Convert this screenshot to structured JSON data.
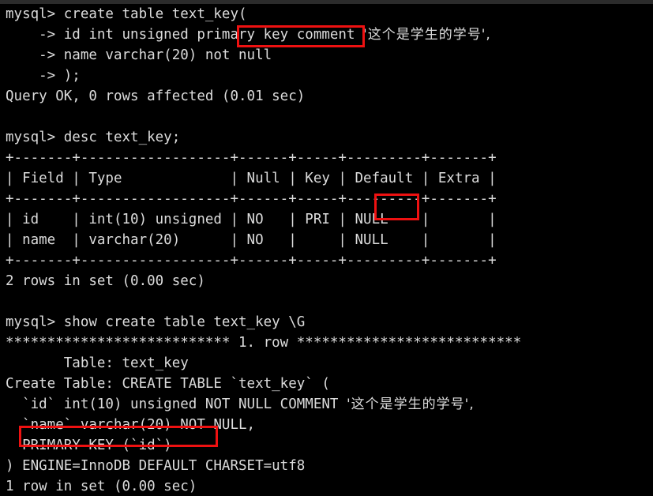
{
  "terminal": {
    "title": "mysql-client-terminal",
    "prompt": "mysql>",
    "background_color": "#000000",
    "text_color": "#dcdcdc",
    "highlight_color": "#ee1111",
    "lines": [
      {
        "id": "l01",
        "text": "mysql> create table text_key("
      },
      {
        "id": "l02",
        "text": "    -> id int unsigned primary key comment ",
        "cn": "'这个是学生的学号',"
      },
      {
        "id": "l03",
        "text": "    -> name varchar(20) not null"
      },
      {
        "id": "l04",
        "text": "    -> );"
      },
      {
        "id": "l05",
        "text": "Query OK, 0 rows affected (0.01 sec)"
      },
      {
        "id": "l06",
        "text": ""
      },
      {
        "id": "l07",
        "text": "mysql> desc text_key;"
      },
      {
        "id": "l08",
        "text": "+-------+------------------+------+-----+---------+-------+"
      },
      {
        "id": "l09",
        "text": "| Field | Type             | Null | Key | Default | Extra |"
      },
      {
        "id": "l10",
        "text": "+-------+------------------+------+-----+---------+-------+"
      },
      {
        "id": "l11",
        "text": "| id    | int(10) unsigned | NO   | PRI | NULL    |       |"
      },
      {
        "id": "l12",
        "text": "| name  | varchar(20)      | NO   |     | NULL    |       |"
      },
      {
        "id": "l13",
        "text": "+-------+------------------+------+-----+---------+-------+"
      },
      {
        "id": "l14",
        "text": "2 rows in set (0.00 sec)"
      },
      {
        "id": "l15",
        "text": ""
      },
      {
        "id": "l16",
        "text": "mysql> show create table text_key \\G"
      },
      {
        "id": "l17",
        "text": "*************************** 1. row ***************************"
      },
      {
        "id": "l18",
        "text": "       Table: text_key"
      },
      {
        "id": "l19",
        "text": "Create Table: CREATE TABLE `text_key` ("
      },
      {
        "id": "l20",
        "text": "  `id` int(10) unsigned NOT NULL COMMENT ",
        "cn": "'这个是学生的学号',"
      },
      {
        "id": "l21",
        "text": "  `name` varchar(20) NOT NULL,"
      },
      {
        "id": "l22",
        "text": "  PRIMARY KEY (`id`)"
      },
      {
        "id": "l23",
        "text": ") ENGINE=InnoDB DEFAULT CHARSET=utf8"
      },
      {
        "id": "l24",
        "text": "1 row in set (0.00 sec)"
      }
    ]
  },
  "annotations": {
    "box_primary_key": {
      "label": "primary key",
      "name": "highlight-primary-key-clause"
    },
    "box_pri": {
      "label": "PRI",
      "name": "highlight-pri-key-column-value"
    },
    "box_primary_key_def": {
      "label": "PRIMARY KEY (`id`)",
      "name": "highlight-primary-key-definition"
    }
  },
  "statements": {
    "create_table": "create table text_key( id int unsigned primary key comment '这个是学生的学号', name varchar(20) not null );",
    "desc": "desc text_key;",
    "show_create": "show create table text_key \\G"
  },
  "results": {
    "create_status": "Query OK, 0 rows affected (0.01 sec)",
    "desc_status": "2 rows in set (0.00 sec)",
    "show_create_status": "1 row in set (0.00 sec)"
  },
  "desc_table": {
    "columns": [
      "Field",
      "Type",
      "Null",
      "Key",
      "Default",
      "Extra"
    ],
    "rows": [
      [
        "id",
        "int(10) unsigned",
        "NO",
        "PRI",
        "NULL",
        ""
      ],
      [
        "name",
        "varchar(20)",
        "NO",
        "",
        "NULL",
        ""
      ]
    ]
  }
}
